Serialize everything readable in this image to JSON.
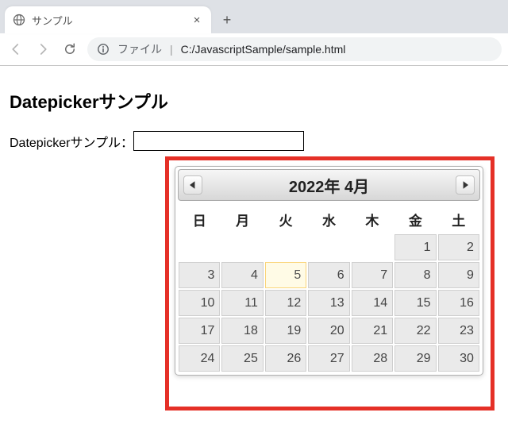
{
  "browser": {
    "tab_title": "サンプル",
    "url_scheme": "ファイル",
    "url_path": "C:/JavascriptSample/sample.html"
  },
  "page": {
    "heading": "Datepickerサンプル",
    "field_label": "Datepickerサンプル：",
    "input_value": ""
  },
  "datepicker": {
    "title": "2022年 4月",
    "dow": [
      "日",
      "月",
      "火",
      "水",
      "木",
      "金",
      "土"
    ],
    "weeks": [
      [
        "",
        "",
        "",
        "",
        "",
        "1",
        "2"
      ],
      [
        "3",
        "4",
        "5",
        "6",
        "7",
        "8",
        "9"
      ],
      [
        "10",
        "11",
        "12",
        "13",
        "14",
        "15",
        "16"
      ],
      [
        "17",
        "18",
        "19",
        "20",
        "21",
        "22",
        "23"
      ],
      [
        "24",
        "25",
        "26",
        "27",
        "28",
        "29",
        "30"
      ]
    ],
    "today": "5"
  }
}
